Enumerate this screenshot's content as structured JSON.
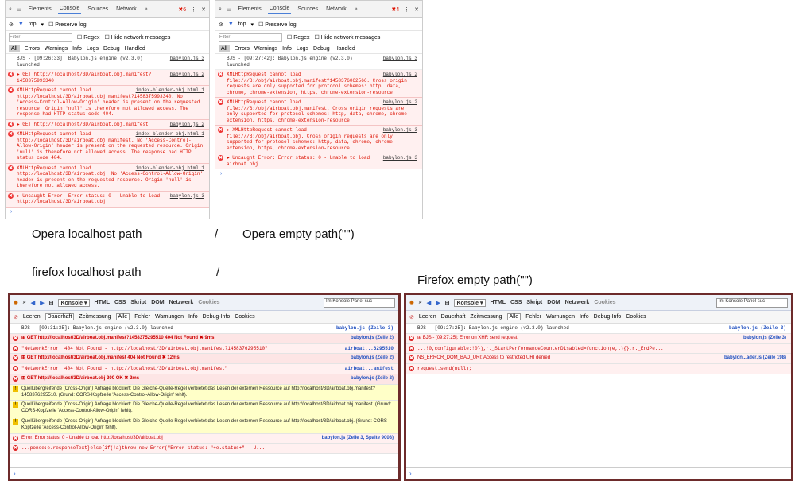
{
  "opera_left": {
    "tabs": [
      "Elements",
      "Console",
      "Sources",
      "Network",
      "»"
    ],
    "errors_badge": "6",
    "frame": "top",
    "preserve_log": "Preserve log",
    "filter_placeholder": "Filter",
    "regex": "Regex",
    "hide_network": "Hide network messages",
    "levels": [
      "All",
      "Errors",
      "Warnings",
      "Info",
      "Logs",
      "Debug",
      "Handled"
    ],
    "messages": [
      {
        "type": "log",
        "text": "BJS - [09:26:33]: Babylon.js engine (v2.3.0) launched",
        "src": "babylon.js:3"
      },
      {
        "type": "err",
        "text": "▶ GET http://localhost/3D/airboat.obj.manifest?1458375993340",
        "src": "babylon.js:2"
      },
      {
        "type": "err",
        "text": "XMLHttpRequest cannot load http://localhost/3D/airboat.obj.manifest?1458375993340. No 'Access-Control-Allow-Origin' header is present on the requested resource. Origin 'null' is therefore not allowed access. The response had HTTP status code 404.",
        "src": "index-blender-obj.html:1"
      },
      {
        "type": "err",
        "text": "▶ GET http://localhost/3D/airboat.obj.manifest",
        "src": "babylon.js:2"
      },
      {
        "type": "err",
        "text": "XMLHttpRequest cannot load http://localhost/3D/airboat.obj.manifest. No 'Access-Control-Allow-Origin' header is present on the requested resource. Origin 'null' is therefore not allowed access. The response had HTTP status code 404.",
        "src": "index-blender-obj.html:1"
      },
      {
        "type": "err",
        "text": "XMLHttpRequest cannot load http://localhost/3D/airboat.obj. No 'Access-Control-Allow-Origin' header is present on the requested resource. Origin 'null' is therefore not allowed access.",
        "src": "index-blender-obj.html:1"
      },
      {
        "type": "err",
        "text": "▶ Uncaught Error: Error status: 0 - Unable to load http://localhost/3D/airboat.obj",
        "src": "babylon.js:3"
      }
    ]
  },
  "opera_right": {
    "tabs": [
      "Elements",
      "Console",
      "Sources",
      "Network",
      "»"
    ],
    "errors_badge": "4",
    "frame": "top",
    "preserve_log": "Preserve log",
    "filter_placeholder": "Filter",
    "regex": "Regex",
    "hide_network": "Hide network messages",
    "levels": [
      "All",
      "Errors",
      "Warnings",
      "Info",
      "Logs",
      "Debug",
      "Handled"
    ],
    "messages": [
      {
        "type": "log",
        "text": "BJS - [09:27:42]: Babylon.js engine (v2.3.0) launched",
        "src": "babylon.js:3"
      },
      {
        "type": "err",
        "text": "XMLHttpRequest cannot load file:///B:/obj/airboat.obj.manifest?1458376062566. Cross origin requests are only supported for protocol schemes: http, data, chrome, chrome-extension, https, chrome-extension-resource.",
        "src": "babylon.js:2"
      },
      {
        "type": "err",
        "text": "XMLHttpRequest cannot load file:///B:/obj/airboat.obj.manifest. Cross origin requests are only supported for protocol schemes: http, data, chrome, chrome-extension, https, chrome-extension-resource.",
        "src": "babylon.js:2"
      },
      {
        "type": "err",
        "text": "▶ XMLHttpRequest cannot load file:///B:/obj/airboat.obj. Cross origin requests are only supported for protocol schemes: http, data, chrome, chrome-extension, https, chrome-extension-resource.",
        "src": "babylon.js:3"
      },
      {
        "type": "err",
        "text": "▶ Uncaught Error: Error status: 0 - Unable to load airboat.obj",
        "src": "babylon.js:3"
      }
    ]
  },
  "captions": {
    "opera_localhost": "Opera localhost path",
    "slash1": "/",
    "opera_empty": "Opera empty path(\"\")",
    "firefox_localhost": "firefox localhost path",
    "slash2": "/",
    "firefox_empty": "Firefox empty path(\"\")"
  },
  "firefox_left": {
    "konsole": "Konsole ▾",
    "tabs": [
      "HTML",
      "CSS",
      "Skript",
      "DOM",
      "Netzwerk",
      "Cookies"
    ],
    "search_placeholder": "Im Konsole Panel suc",
    "filters": [
      "Leeren",
      "Dauerhaft",
      "Zeitmessung",
      "Alle",
      "Fehler",
      "Warnungen",
      "Info",
      "Debug-Info",
      "Cookies"
    ],
    "messages": [
      {
        "type": "log",
        "text": "BJS - [09:31:35]: Babylon.js engine (v2.3.0) launched",
        "src": "babylon.js (Zeile 3)",
        "mono": true
      },
      {
        "type": "get",
        "text": "⊞ GET http://localhost/3D/airboat.obj.manifest?1458375295510   404 Not Found  ✖  9ms",
        "src": "babylon.js (Zeile 2)",
        "mono": false
      },
      {
        "type": "err",
        "text": "\"NetworkError: 404 Not Found - http://localhost/3D/airboat.obj.manifest?1458376295510\"",
        "src": "airboat...6295510",
        "mono": true
      },
      {
        "type": "get",
        "text": "⊞ GET http://localhost/3D/airboat.obj.manifest   404 Not Found  ✖  12ms",
        "src": "babylon.js (Zeile 2)",
        "mono": false
      },
      {
        "type": "err",
        "text": "\"NetworkError: 404 Not Found - http://localhost/3D/airboat.obj.manifest\"",
        "src": "airboat...anifest",
        "mono": true
      },
      {
        "type": "get",
        "text": "⊞ GET http://localhost/3D/airboat.obj   200 OK  ✖  2ms",
        "src": "babylon.js (Zeile 2)",
        "mono": false
      },
      {
        "type": "warn",
        "text": "Quellübergreifende (Cross-Origin) Anfrage blockiert: Die Gleiche-Quelle-Regel verbietet das Lesen der externen Ressource auf http://localhost/3D/airboat.obj.manifest?1458376295510. (Grund: CORS-Kopfzeile 'Access-Control-Allow-Origin' fehlt).",
        "src": "",
        "mono": false
      },
      {
        "type": "warn",
        "text": "Quellübergreifende (Cross-Origin) Anfrage blockiert: Die Gleiche-Quelle-Regel verbietet das Lesen der externen Ressource auf http://localhost/3D/airboat.obj.manifest. (Grund: CORS-Kopfzeile 'Access-Control-Allow-Origin' fehlt).",
        "src": "",
        "mono": false
      },
      {
        "type": "warn",
        "text": "Quellübergreifende (Cross-Origin) Anfrage blockiert: Die Gleiche-Quelle-Regel verbietet das Lesen der externen Ressource auf http://localhost/3D/airboat.obj. (Grund: CORS-Kopfzeile 'Access-Control-Allow-Origin' fehlt).",
        "src": "",
        "mono": false
      },
      {
        "type": "err",
        "text": "Error: Error status: 0 - Unable to load http://localhost/3D/airboat.obj",
        "src": "babylon.js (Zeile 3, Spalte 9008)",
        "mono": false
      },
      {
        "type": "err",
        "text": "...ponse:e.responseText}else{if(!a)throw new Error(\"Error status: \"+e.status+\" - U...",
        "src": "",
        "mono": true
      }
    ],
    "prompt": "›"
  },
  "firefox_right": {
    "konsole": "Konsole ▾",
    "tabs": [
      "HTML",
      "CSS",
      "Skript",
      "DOM",
      "Netzwerk",
      "Cookies"
    ],
    "search_placeholder": "Im Konsole Panel suc",
    "filters": [
      "Leeren",
      "Dauerhaft",
      "Zeitmessung",
      "Alle",
      "Fehler",
      "Warnungen",
      "Info",
      "Debug-Info",
      "Cookies"
    ],
    "messages": [
      {
        "type": "log",
        "text": "BJS - [09:27:25]: Babylon.js engine (v2.3.0) launched",
        "src": "babylon.js (Zeile 3)",
        "mono": true
      },
      {
        "type": "err",
        "text": "⊞ BJS - [09:27:25]: Error on XHR send request.",
        "src": "babylon.js (Zeile 3)",
        "mono": false
      },
      {
        "type": "err",
        "text": "...!0,configurable:!0}),r._StartPerformanceCounterDisabled=function(e,t){},r._EndPe...",
        "src": "",
        "mono": true
      },
      {
        "type": "err",
        "text": "NS_ERROR_DOM_BAD_URI: Access to restricted URI denied",
        "src": "babylon...ader.js (Zeile 198)",
        "mono": false
      },
      {
        "type": "err",
        "text": "request.send(null);",
        "src": "",
        "mono": true
      }
    ],
    "prompt": "›"
  }
}
